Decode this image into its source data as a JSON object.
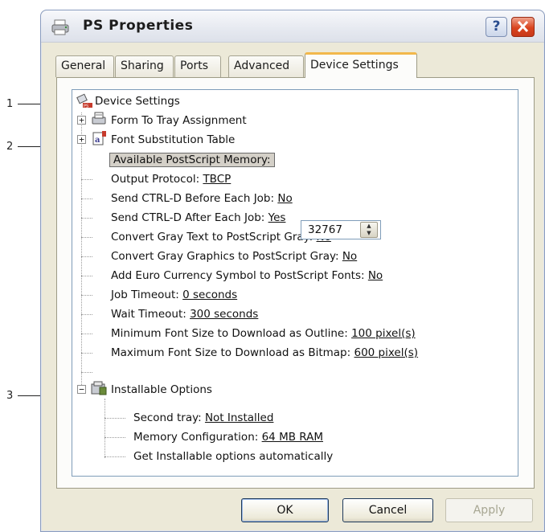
{
  "window": {
    "title": "PS Properties"
  },
  "tabs": [
    {
      "label": "General"
    },
    {
      "label": "Sharing"
    },
    {
      "label": "Ports"
    },
    {
      "label": "Advanced"
    },
    {
      "label": "Device Settings"
    }
  ],
  "callouts": [
    "1",
    "2",
    "3"
  ],
  "tree": {
    "root": "Device Settings",
    "form_to_tray": "Form To Tray Assignment",
    "font_substitution": "Font Substitution Table",
    "memory": {
      "label": "Available PostScript Memory:",
      "value": "32767"
    },
    "items": [
      {
        "label": "Output Protocol:",
        "value": "TBCP"
      },
      {
        "label": "Send CTRL-D Before Each Job:",
        "value": "No"
      },
      {
        "label": "Send CTRL-D After Each Job:",
        "value": "Yes"
      },
      {
        "label": "Convert Gray Text to PostScript Gray:",
        "value": "No"
      },
      {
        "label": "Convert Gray Graphics to PostScript Gray:",
        "value": "No"
      },
      {
        "label": "Add Euro Currency Symbol to PostScript Fonts:",
        "value": "No"
      },
      {
        "label": "Job Timeout:",
        "value": "0 seconds"
      },
      {
        "label": "Wait Timeout:",
        "value": "300 seconds"
      },
      {
        "label": "Minimum Font Size to Download as Outline:",
        "value": "100 pixel(s)"
      },
      {
        "label": "Maximum Font Size to Download as Bitmap:",
        "value": "600 pixel(s)"
      }
    ],
    "installable": {
      "label": "Installable Options",
      "items": [
        {
          "label": "Second tray:",
          "value": "Not Installed"
        },
        {
          "label": "Memory Configuration:",
          "value": "64 MB RAM"
        },
        {
          "label": "Get Installable options automatically",
          "value": ""
        }
      ]
    }
  },
  "buttons": {
    "ok": "OK",
    "cancel": "Cancel",
    "apply": "Apply"
  },
  "icons": {
    "printer": "printer-icon",
    "root": "device-settings-icon",
    "form_tray": "form-tray-icon",
    "font": "font-substitution-icon",
    "installable": "installable-options-icon"
  }
}
